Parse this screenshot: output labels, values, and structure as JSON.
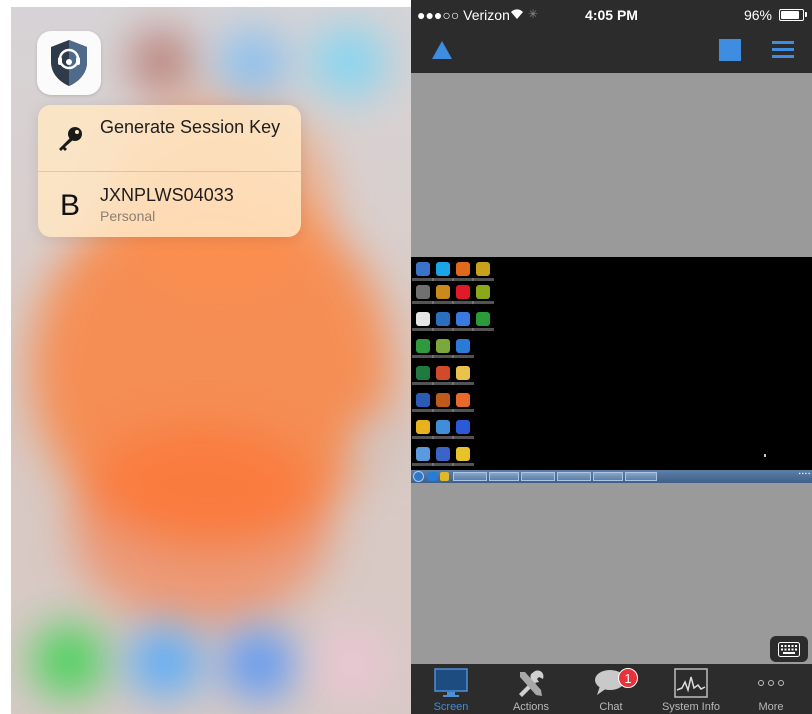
{
  "left_panel": {
    "quick_actions": [
      {
        "title": "Generate Session Key",
        "icon": "key-icon"
      },
      {
        "title": "JXNPLWS04033",
        "subtitle": "Personal",
        "glyph": "B"
      }
    ],
    "app_icon": "headset-shield-icon"
  },
  "status_bar": {
    "carrier": "●●●○○ Verizon",
    "time": "4:05 PM",
    "battery": "96%",
    "battery_level": 0.96
  },
  "toolbar": {
    "left_icon": "triangle-icon",
    "right_icons": [
      "square-icon",
      "menu-icon"
    ]
  },
  "tabs": [
    {
      "label": "Screen",
      "icon": "monitor-icon",
      "active": true
    },
    {
      "label": "Actions",
      "icon": "tools-icon",
      "active": false
    },
    {
      "label": "Chat",
      "icon": "chat-bubble-icon",
      "active": false,
      "badge": "1"
    },
    {
      "label": "System Info",
      "icon": "graph-icon",
      "active": false
    },
    {
      "label": "More",
      "icon": "more-icon",
      "active": false
    }
  ],
  "colors": {
    "accent": "#3e8de0",
    "bar_bg": "#2c2c2c",
    "canvas_bg": "#9a9a9a",
    "badge": "#e8323b"
  }
}
